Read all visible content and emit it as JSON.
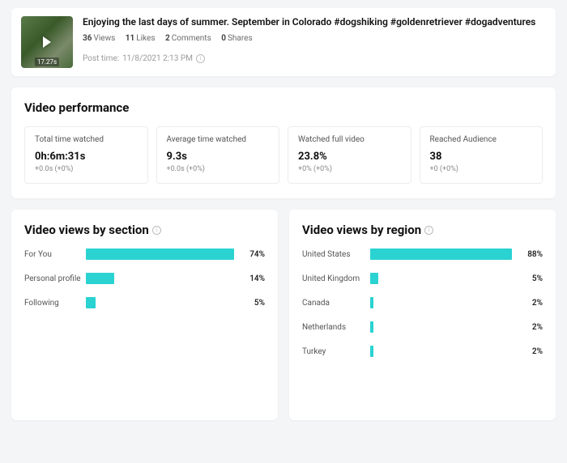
{
  "header": {
    "title": "Enjoying the last days of summer. September in Colorado #dogshiking #goldenretriever #dogadventures",
    "duration": "17.27s",
    "stats": {
      "views_val": "36",
      "views_lbl": "Views",
      "likes_val": "11",
      "likes_lbl": "Likes",
      "comments_val": "2",
      "comments_lbl": "Comments",
      "shares_val": "0",
      "shares_lbl": "Shares"
    },
    "post_time_label": "Post time:",
    "post_time_value": "11/8/2021 2:13 PM"
  },
  "performance": {
    "title": "Video performance",
    "metrics": [
      {
        "label": "Total time watched",
        "value": "0h:6m:31s",
        "delta": "+0.0s (+0%)"
      },
      {
        "label": "Average time watched",
        "value": "9.3s",
        "delta": "+0.0s (+0%)"
      },
      {
        "label": "Watched full video",
        "value": "23.8%",
        "delta": "+0% (+0%)"
      },
      {
        "label": "Reached Audience",
        "value": "38",
        "delta": "+0 (+0%)"
      }
    ]
  },
  "views_by_section": {
    "title": "Video views by section",
    "items": [
      {
        "name": "For You",
        "pct": 74
      },
      {
        "name": "Personal profile",
        "pct": 14
      },
      {
        "name": "Following",
        "pct": 5
      }
    ]
  },
  "views_by_region": {
    "title": "Video views by region",
    "items": [
      {
        "name": "United States",
        "pct": 88
      },
      {
        "name": "United Kingdom",
        "pct": 5
      },
      {
        "name": "Canada",
        "pct": 2
      },
      {
        "name": "Netherlands",
        "pct": 2
      },
      {
        "name": "Turkey",
        "pct": 2
      }
    ]
  },
  "chart_data": [
    {
      "type": "bar",
      "title": "Video views by section",
      "categories": [
        "For You",
        "Personal profile",
        "Following"
      ],
      "values": [
        74,
        14,
        5
      ],
      "xlabel": "",
      "ylabel": "",
      "ylim": [
        0,
        100
      ]
    },
    {
      "type": "bar",
      "title": "Video views by region",
      "categories": [
        "United States",
        "United Kingdom",
        "Canada",
        "Netherlands",
        "Turkey"
      ],
      "values": [
        88,
        5,
        2,
        2,
        2
      ],
      "xlabel": "",
      "ylabel": "",
      "ylim": [
        0,
        100
      ]
    }
  ],
  "colors": {
    "accent_bar": "#2ad2d2"
  }
}
